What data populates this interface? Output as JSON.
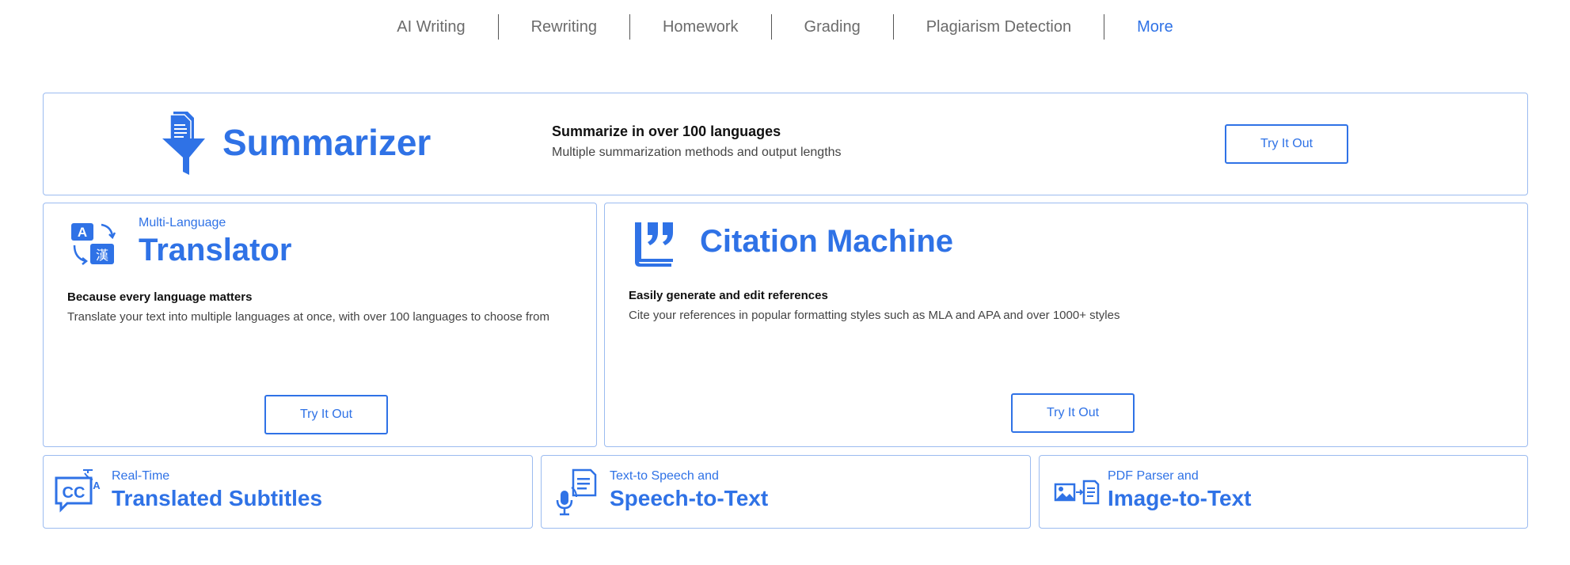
{
  "nav": {
    "items": [
      "AI Writing",
      "Rewriting",
      "Homework",
      "Grading",
      "Plagiarism Detection"
    ],
    "more": "More"
  },
  "summarizer": {
    "icon": "funnel-document-icon",
    "title": "Summarizer",
    "heading": "Summarize in over 100 languages",
    "text": "Multiple summarization methods and output lengths",
    "button": "Try It Out"
  },
  "translator": {
    "icon": "translate-icon",
    "icon_glyphs": {
      "latin": "A",
      "cjk": "漢"
    },
    "label": "Multi-Language",
    "title": "Translator",
    "heading": "Because every language matters",
    "text": "Translate your text into multiple languages at once, with over 100 languages to choose from",
    "button": "Try It Out"
  },
  "citation": {
    "icon": "quote-book-icon",
    "title": "Citation Machine",
    "heading": "Easily generate and edit references",
    "text": "Cite your references in popular formatting styles such as MLA and APA and over 1000+ styles",
    "button": "Try It Out"
  },
  "subtitles": {
    "icon": "closed-caption-translate-icon",
    "icon_glyphs": {
      "cc": "CC",
      "latin": "A"
    },
    "label": "Real-Time",
    "title": "Translated Subtitles"
  },
  "speech": {
    "icon": "microphone-document-icon",
    "label": "Text-to Speech and",
    "title": "Speech-to-Text"
  },
  "image_text": {
    "icon": "image-to-text-icon",
    "label": "PDF Parser and",
    "title": "Image-to-Text"
  },
  "colors": {
    "accent": "#2f72e6",
    "border": "#9bbbf0"
  }
}
